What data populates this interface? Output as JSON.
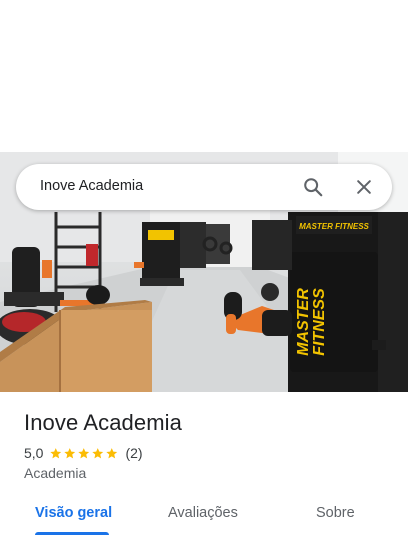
{
  "search": {
    "query": "Inove Academia",
    "search_icon": "search-icon",
    "close_icon": "close-icon"
  },
  "place": {
    "name": "Inove Academia",
    "rating": "5,0",
    "stars_filled": 5,
    "stars_total": 5,
    "review_count": "(2)",
    "category": "Academia"
  },
  "photo": {
    "machine_brand": "MASTER FITNESS"
  },
  "tabs": [
    {
      "label": "Visão geral",
      "active": true
    },
    {
      "label": "Avaliações",
      "active": false
    },
    {
      "label": "Sobre",
      "active": false
    }
  ],
  "colors": {
    "accent": "#1a73e8",
    "star": "#fbbc04",
    "machine_frame": "#1c1c1c",
    "machine_brand": "#f2c300",
    "pad_orange": "#e8762b"
  }
}
